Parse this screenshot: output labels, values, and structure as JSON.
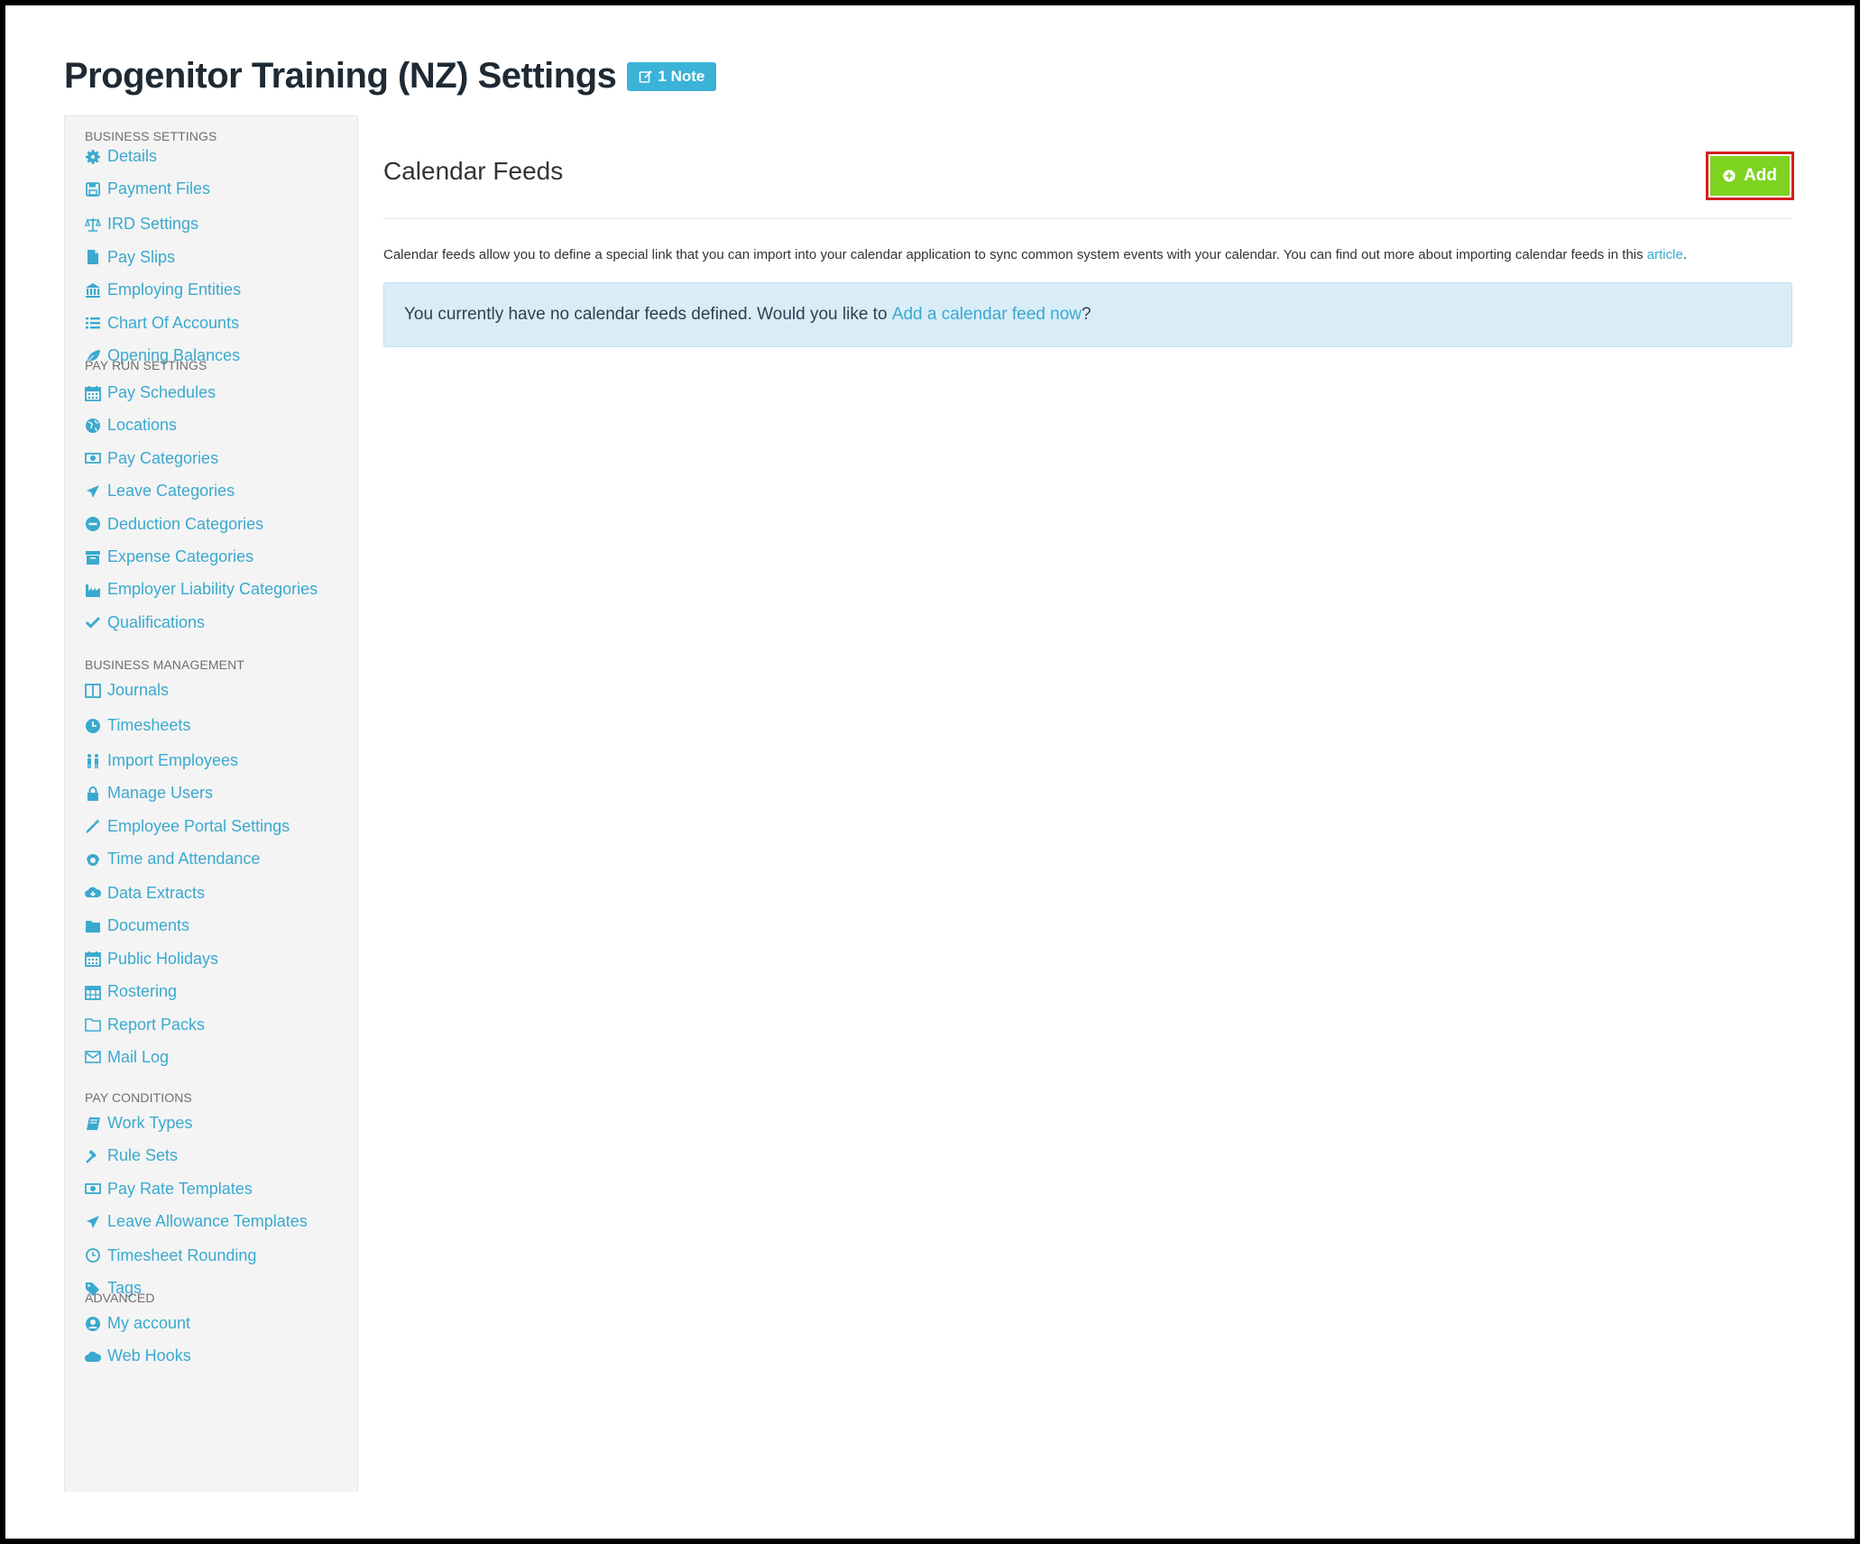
{
  "page": {
    "title": "Progenitor Training (NZ) Settings",
    "note_badge": "1 Note"
  },
  "sidebar": {
    "sections": [
      {
        "title": "BUSINESS SETTINGS",
        "items": [
          {
            "label": "Details",
            "icon": "gear-icon"
          },
          {
            "label": "Payment Files",
            "icon": "floppy-icon"
          },
          {
            "label": "IRD Settings",
            "icon": "scale-icon"
          },
          {
            "label": "Pay Slips",
            "icon": "file-icon"
          },
          {
            "label": "Employing Entities",
            "icon": "bank-icon"
          },
          {
            "label": "Chart Of Accounts",
            "icon": "list-icon"
          },
          {
            "label": "Opening Balances",
            "icon": "leaf-icon"
          }
        ]
      },
      {
        "title": "PAY RUN SETTINGS",
        "items": [
          {
            "label": "Pay Schedules",
            "icon": "calendar-icon"
          },
          {
            "label": "Locations",
            "icon": "globe-icon"
          },
          {
            "label": "Pay Categories",
            "icon": "money-icon"
          },
          {
            "label": "Leave Categories",
            "icon": "plane-icon"
          },
          {
            "label": "Deduction Categories",
            "icon": "minus-circle-icon"
          },
          {
            "label": "Expense Categories",
            "icon": "archive-icon"
          },
          {
            "label": "Employer Liability Categories",
            "icon": "industry-icon"
          },
          {
            "label": "Qualifications",
            "icon": "check-icon"
          }
        ]
      },
      {
        "title": "BUSINESS MANAGEMENT",
        "items": [
          {
            "label": "Journals",
            "icon": "columns-icon"
          },
          {
            "label": "Timesheets",
            "icon": "clock-icon"
          },
          {
            "label": "Import Employees",
            "icon": "users-icon"
          },
          {
            "label": "Manage Users",
            "icon": "lock-icon"
          },
          {
            "label": "Employee Portal Settings",
            "icon": "magic-wand-icon"
          },
          {
            "label": "Time and Attendance",
            "icon": "headset-icon"
          },
          {
            "label": "Data Extracts",
            "icon": "cloud-download-icon"
          },
          {
            "label": "Documents",
            "icon": "folder-icon"
          },
          {
            "label": "Public Holidays",
            "icon": "calendar-icon"
          },
          {
            "label": "Rostering",
            "icon": "calendar-grid-icon"
          },
          {
            "label": "Report Packs",
            "icon": "folder-open-icon"
          },
          {
            "label": "Mail Log",
            "icon": "envelope-icon"
          }
        ]
      },
      {
        "title": "PAY CONDITIONS",
        "items": [
          {
            "label": "Work Types",
            "icon": "book-icon"
          },
          {
            "label": "Rule Sets",
            "icon": "gavel-icon"
          },
          {
            "label": "Pay Rate Templates",
            "icon": "money-icon"
          },
          {
            "label": "Leave Allowance Templates",
            "icon": "plane-icon"
          },
          {
            "label": "Timesheet Rounding",
            "icon": "clock-outline-icon"
          },
          {
            "label": "Tags",
            "icon": "tag-icon"
          }
        ]
      },
      {
        "title": "ADVANCED",
        "items": [
          {
            "label": "My account",
            "icon": "user-circle-icon"
          },
          {
            "label": "Web Hooks",
            "icon": "cloud-icon"
          }
        ]
      }
    ]
  },
  "main": {
    "title": "Calendar Feeds",
    "add_label": "Add",
    "description": "Calendar feeds allow you to define a special link that you can import into your calendar application to sync common system events with your calendar. You can find out more about importing calendar feeds in this",
    "description_link": "article",
    "description_end": ".",
    "alert_text": "You currently have no calendar feeds defined. Would you like to",
    "alert_link": "Add a calendar feed now",
    "alert_end": "?"
  },
  "colors": {
    "link": "#3aa9cf",
    "add_button": "#7ed321",
    "highlight": "#d42020",
    "badge": "#3bb2d8",
    "alert_bg": "#d9edf7"
  }
}
